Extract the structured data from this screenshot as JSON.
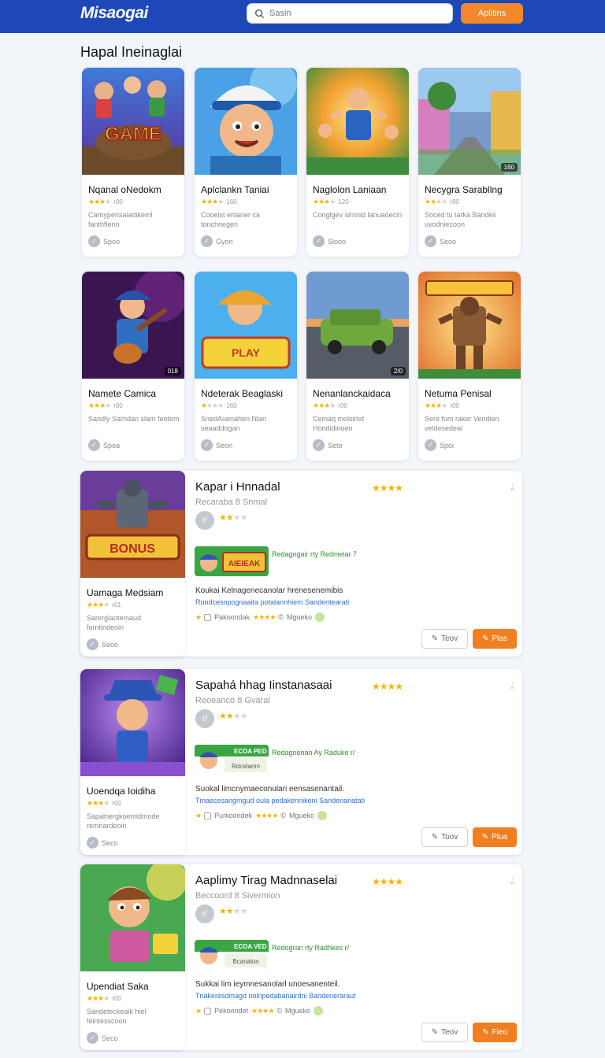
{
  "header": {
    "logo": "Misaogai",
    "search_placeholder": "Sasin",
    "button_label": "Aplitins"
  },
  "section": {
    "title": "Hapal Ineinaglai"
  },
  "cards": [
    {
      "title": "Nqanal oNedokm",
      "rating": "r00",
      "desc": "Carnypensaiadikeml fanthfienn",
      "foot": "Spoo",
      "stars": 3
    },
    {
      "title": "Aplclankn Taniai",
      "rating": "160",
      "desc": "Cooeist enlaner ca tonchnegen",
      "foot": "Gyon",
      "stars": 3
    },
    {
      "title": "Naglolon Laniaan",
      "rating": "120",
      "desc": "Conglgev sirnnid lanuaoecin",
      "foot": "Sioon",
      "stars": 3
    },
    {
      "title": "Necygra Sarabllng",
      "rating": "r80",
      "desc": "Soced tu tarka Bandes uvodniecoon",
      "foot": "Seoo",
      "stars": 2,
      "badge": "160"
    },
    {
      "title": "Namete Camica",
      "rating": "r00",
      "desc": "Sandly Sarndan slam fentem",
      "foot": "Spoa",
      "stars": 3,
      "badge": "018"
    },
    {
      "title": "Ndeterak Beaglaski",
      "rating": "160",
      "desc": "SnedAuenahen Nlan seaaddogan",
      "foot": "Seon",
      "stars": 1
    },
    {
      "title": "Nenanlanckaidaca",
      "rating": "r00",
      "desc": "Cemaq molsimd Hondidinoen",
      "foot": "Seto",
      "stars": 3,
      "badge": "2/0"
    },
    {
      "title": "Netuma Penisal",
      "rating": "r00",
      "desc": "Sere fum raker Vendien veldesedeal",
      "foot": "Spoi",
      "stars": 3
    }
  ],
  "panels": [
    {
      "card": {
        "title": "Uamaga Medsiam",
        "rating": "r01",
        "desc": "Sarerglaotemaud forntindeoin",
        "foot": "Seoo",
        "stars": 3
      },
      "title": "Kapar i Hnnadal",
      "subtitle": "Recaraba 8 Snmal",
      "avatar": "r/",
      "ad_label": "Redagngair rty Redmelar 7",
      "ad_text": "AIEIEAK",
      "desc1": "Koukai Kelnagenecanolar hrenesenemibis",
      "desc2": "Rundcesnpognaaita potalannhiem Sandentearati",
      "meta1": "Pakoondak",
      "meta2": "Mgueko",
      "btn1": "Teov",
      "btn2": "Plas",
      "stars_b": 2
    },
    {
      "card": {
        "title": "Uoendqa Ioidiha",
        "rating": "r00",
        "desc": "Sapalnergkoemidmode remnardeoin",
        "foot": "Seco",
        "stars": 3
      },
      "title": "Sapahá hhag Iinstanasaai",
      "subtitle": "Reoeanco 8 Gvaral",
      "avatar": "r/",
      "ad_label": "Redagnenan Ay Raduke r/",
      "ad_text": "Rdcelamn",
      "ad_top": "ECOA PED",
      "desc1": "Suokal limcnymaeconulari eensasenantail.",
      "desc2": "Tmaecesangmgud oula pedakennikeni Sandenanatati",
      "meta1": "Purkoondek",
      "meta2": "Mgueko",
      "btn1": "Toov",
      "btn2": "Plua",
      "stars_b": 2
    },
    {
      "card": {
        "title": "Upendiat Saka",
        "rating": "r00",
        "desc": "Sandeteckeaik hiel feintesscoon",
        "foot": "Seco",
        "stars": 3
      },
      "title": "Aaplimy Tirag Madnnaselai",
      "subtitle": "Beccoord 8 Sivermion",
      "avatar": "r/",
      "ad_label": "Redogran rty Radhkes r/",
      "ad_text": "Bcanalon",
      "ad_top": "ECOA VED",
      "desc1": "Sukkai lim ieymnesanolarl unoesanenteil.",
      "desc2": "Tnakeresdmagd nolnpedabanairdni Bandeneraraut",
      "meta1": "Pekoondet",
      "meta2": "Mgueko",
      "btn1": "Teov",
      "btn2": "Fieo",
      "stars_b": 2
    }
  ],
  "colors": {
    "header": "#1e47b8",
    "accent": "#f5882a",
    "star": "#f4b400"
  }
}
